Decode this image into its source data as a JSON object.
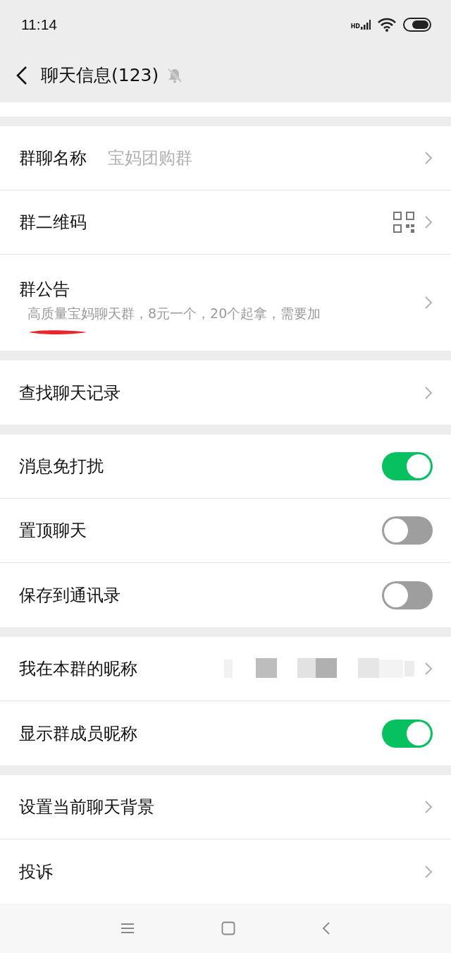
{
  "status_bar": {
    "time": "11:14",
    "network": "HD"
  },
  "header": {
    "title": "聊天信息(123)",
    "muted": true
  },
  "sections": [
    {
      "rows": [
        {
          "kind": "value",
          "label": "群聊名称",
          "value": "宝妈团购群"
        },
        {
          "kind": "qrcode",
          "label": "群二维码"
        },
        {
          "kind": "notice",
          "label": "群公告",
          "text": "高质量宝妈聊天群，8元一个，20个起拿，需要加"
        }
      ]
    },
    {
      "rows": [
        {
          "kind": "link",
          "label": "查找聊天记录"
        }
      ]
    },
    {
      "rows": [
        {
          "kind": "toggle",
          "label": "消息免打扰",
          "on": true
        },
        {
          "kind": "toggle",
          "label": "置顶聊天",
          "on": false
        },
        {
          "kind": "toggle",
          "label": "保存到通讯录",
          "on": false
        }
      ]
    },
    {
      "rows": [
        {
          "kind": "hidden",
          "label": "我在本群的昵称"
        },
        {
          "kind": "toggle",
          "label": "显示群成员昵称",
          "on": true
        }
      ]
    },
    {
      "rows": [
        {
          "kind": "link",
          "label": "设置当前聊天背景"
        },
        {
          "kind": "link",
          "label": "投诉"
        }
      ]
    }
  ]
}
